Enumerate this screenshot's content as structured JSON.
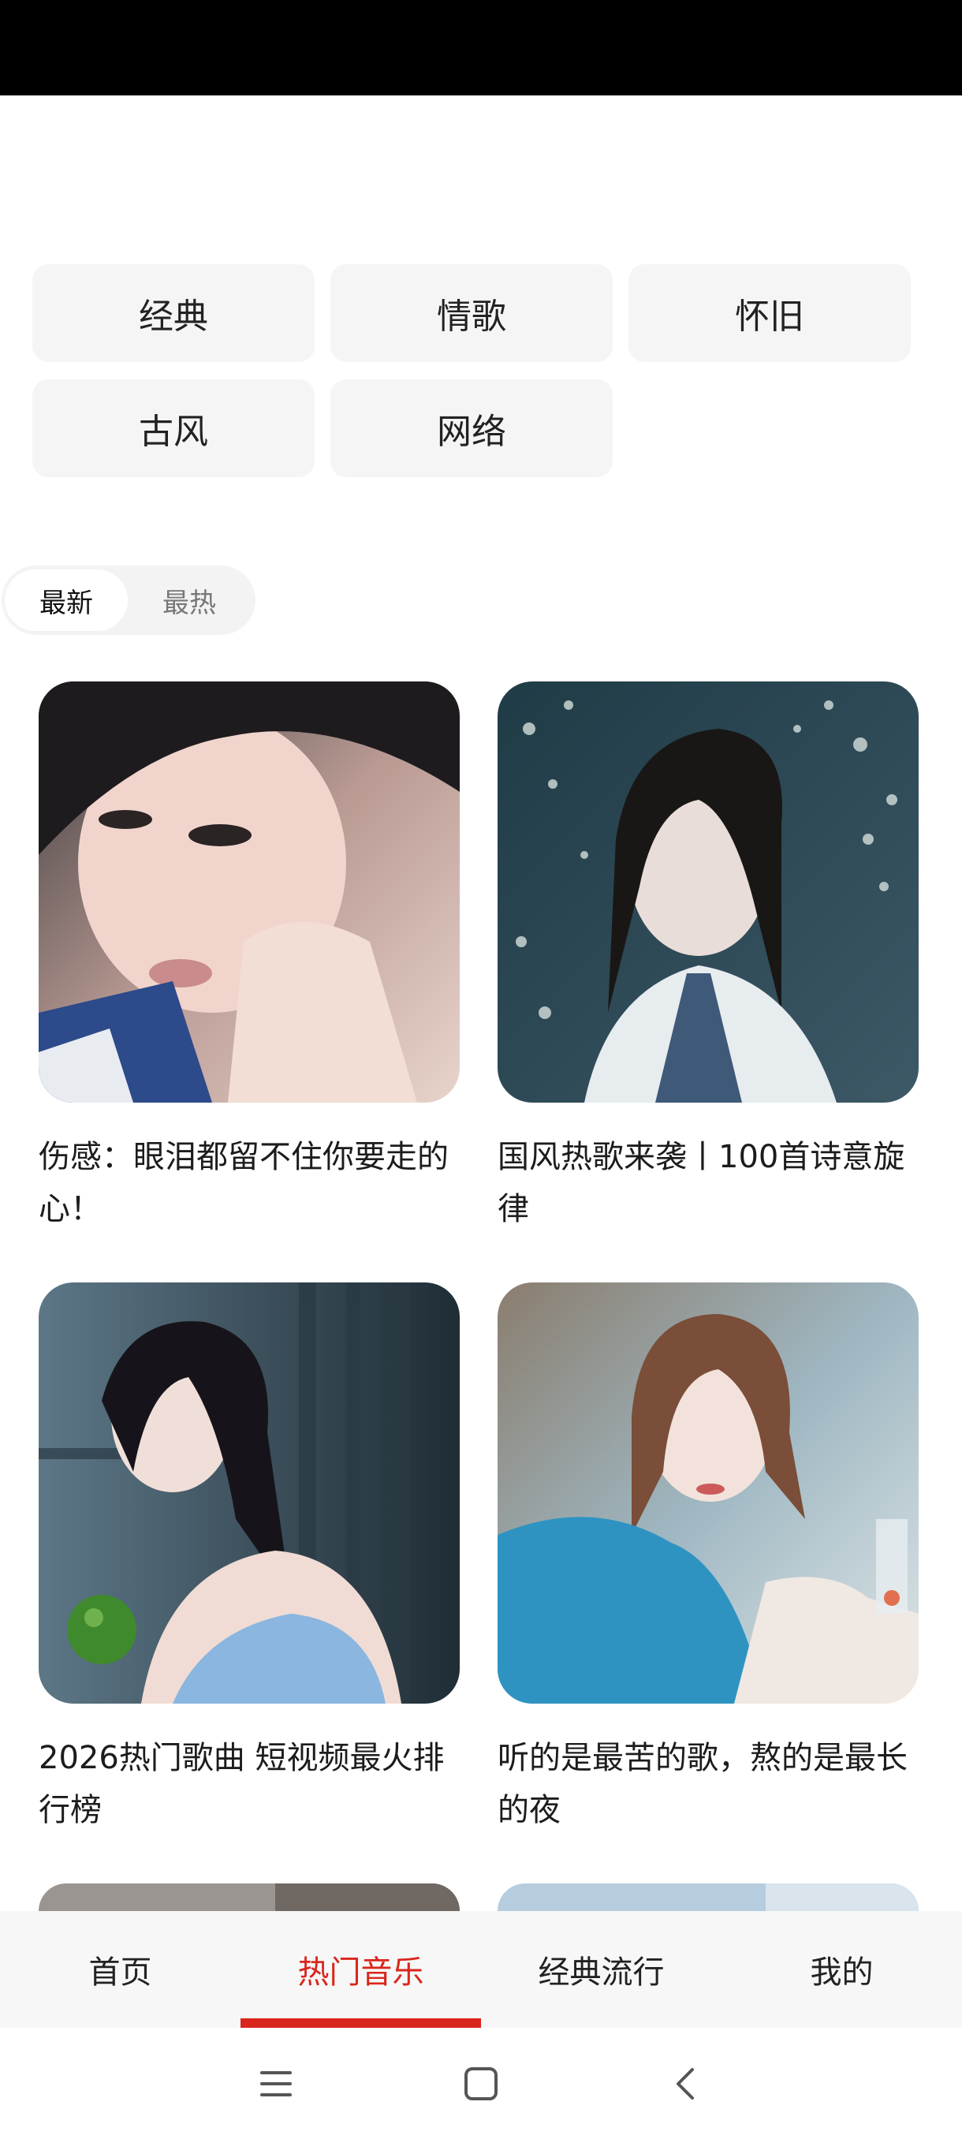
{
  "categories": [
    "经典",
    "情歌",
    "怀旧",
    "古风",
    "网络"
  ],
  "sort": {
    "options": [
      "最新",
      "最热"
    ],
    "selected": "最新"
  },
  "playlists": [
    {
      "title": "伤感：眼泪都留不住你要走的心！"
    },
    {
      "title": "国风热歌来袭丨100首诗意旋律"
    },
    {
      "title": "2026热门歌曲 短视频最火排行榜"
    },
    {
      "title": "听的是最苦的歌，熬的是最长的夜"
    }
  ],
  "tab_bar": {
    "items": [
      "首页",
      "热门音乐",
      "经典流行",
      "我的"
    ],
    "active": "热门音乐",
    "active_color": "#d9261c"
  },
  "system_nav": {
    "icons": [
      "menu-icon",
      "home-square-icon",
      "back-chevron-icon"
    ]
  }
}
